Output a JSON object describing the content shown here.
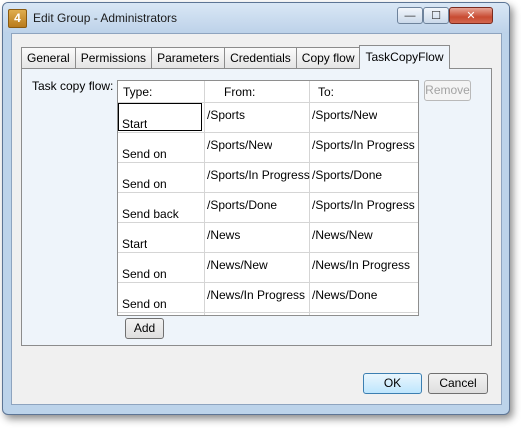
{
  "window": {
    "title": "Edit Group - Administrators",
    "app_icon_text": "4",
    "controls": {
      "minimize": "—",
      "maximize": "☐",
      "close": "✕"
    }
  },
  "tabs": [
    {
      "label": "General",
      "active": false
    },
    {
      "label": "Permissions",
      "active": false
    },
    {
      "label": "Parameters",
      "active": false
    },
    {
      "label": "Credentials",
      "active": false
    },
    {
      "label": "Copy flow",
      "active": false
    },
    {
      "label": "TaskCopyFlow",
      "active": true
    }
  ],
  "task_copy_flow": {
    "label": "Task copy flow:",
    "columns": [
      "Type:",
      "From:",
      "To:"
    ],
    "rows": [
      {
        "type": "Start",
        "from": "/Sports",
        "to": "/Sports/New"
      },
      {
        "type": "Send on",
        "from": "/Sports/New",
        "to": "/Sports/In Progress"
      },
      {
        "type": "Send on",
        "from": "/Sports/In Progress",
        "to": "/Sports/Done"
      },
      {
        "type": "Send back",
        "from": "/Sports/Done",
        "to": "/Sports/In Progress"
      },
      {
        "type": "Start",
        "from": "/News",
        "to": "/News/New"
      },
      {
        "type": "Send on",
        "from": "/News/New",
        "to": "/News/In Progress"
      },
      {
        "type": "Send on",
        "from": "/News/In Progress",
        "to": "/News/Done"
      }
    ],
    "remove_label": "Remove",
    "add_label": "Add"
  },
  "footer": {
    "ok_label": "OK",
    "cancel_label": "Cancel"
  }
}
